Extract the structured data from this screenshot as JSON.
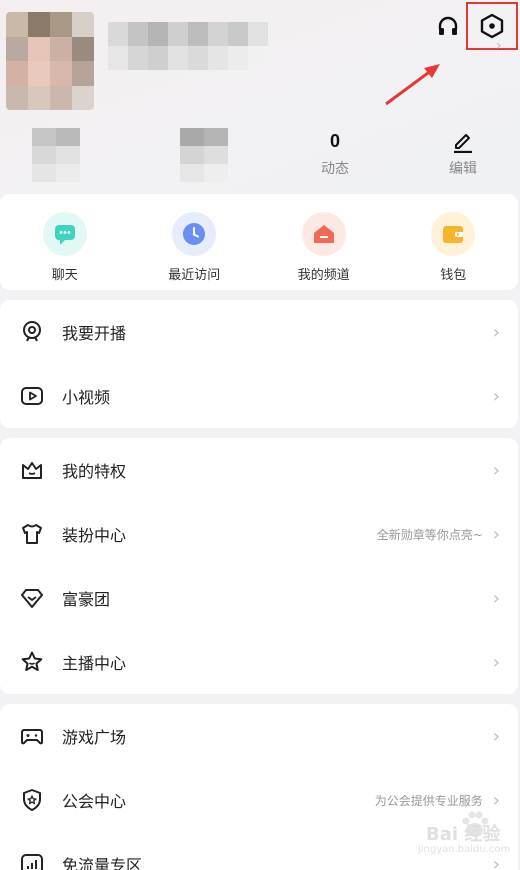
{
  "profile": {
    "avatar_colors": [
      "#c9b9a9",
      "#8a7a6a",
      "#a89886",
      "#d8d0c8",
      "#b9a9a0",
      "#e6c4b8",
      "#cbb0a5",
      "#9a8a80",
      "#d5b0a4",
      "#e9c9bd",
      "#d8b8ac",
      "#b6a49a",
      "#c8b8ae",
      "#d9c7be",
      "#cbb7ad",
      "#ddd3ce"
    ],
    "name_colors": [
      "#d9d9d9",
      "#c4c4c4",
      "#b5b5b5",
      "#cfcfcf",
      "#bdbdbd",
      "#d3d3d3",
      "#c9c9c9",
      "#e2e2e2",
      "#e7e7e7",
      "#d6d6d6",
      "#cfcfcf",
      "#e1e1e1",
      "#dadada",
      "#e5e5e5",
      "#ececec",
      "#f1f1f1"
    ]
  },
  "stats": [
    {
      "value": "",
      "label": ""
    },
    {
      "value": "",
      "label": ""
    },
    {
      "value": "0",
      "label": "动态"
    },
    {
      "value": "",
      "label": "编辑"
    }
  ],
  "quick_actions": [
    {
      "label": "聊天",
      "color": "#3fd3c0",
      "bg": "#e2f8f4",
      "icon": "chat-icon"
    },
    {
      "label": "最近访问",
      "color": "#6b8ef2",
      "bg": "#e6ecfb",
      "icon": "clock-icon"
    },
    {
      "label": "我的频道",
      "color": "#f06a55",
      "bg": "#fde9e4",
      "icon": "house-icon"
    },
    {
      "label": "钱包",
      "color": "#f7b42c",
      "bg": "#fff2d8",
      "icon": "wallet-icon"
    }
  ],
  "menu_group_1": [
    {
      "label": "我要开播",
      "hint": "",
      "icon": "webcam-icon"
    },
    {
      "label": "小视频",
      "hint": "",
      "icon": "play-icon"
    }
  ],
  "menu_group_2": [
    {
      "label": "我的特权",
      "hint": "",
      "icon": "crown-icon"
    },
    {
      "label": "装扮中心",
      "hint": "全新勋章等你点亮~",
      "icon": "shirt-icon"
    },
    {
      "label": "富豪团",
      "hint": "",
      "icon": "diamond-icon"
    },
    {
      "label": "主播中心",
      "hint": "",
      "icon": "star-icon"
    }
  ],
  "menu_group_3": [
    {
      "label": "游戏广场",
      "hint": "",
      "icon": "gamepad-icon"
    },
    {
      "label": "公会中心",
      "hint": "为公会提供专业服务",
      "icon": "shield-icon"
    },
    {
      "label": "免流量专区",
      "hint": "",
      "icon": "signal-icon"
    }
  ],
  "chevron": "›",
  "watermark": {
    "text": "Bai 经验",
    "sub": "jingyan.baidu.com"
  }
}
